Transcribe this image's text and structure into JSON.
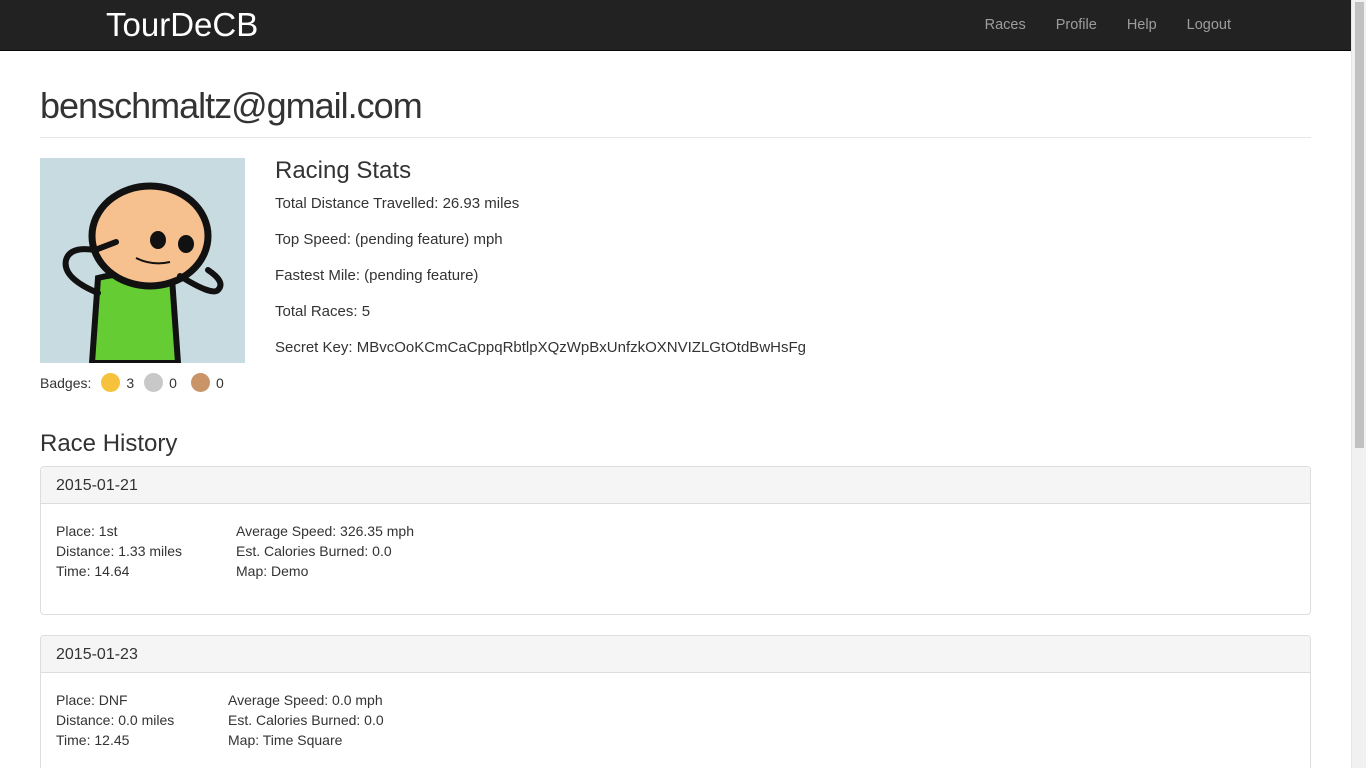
{
  "nav": {
    "brand": "TourDeCB",
    "links": [
      "Races",
      "Profile",
      "Help",
      "Logout"
    ]
  },
  "profile": {
    "email": "benschmaltz@gmail.com",
    "badges_label": "Badges:",
    "badges": {
      "gold": "3",
      "silver": "0",
      "bronze": "0"
    }
  },
  "stats": {
    "title": "Racing Stats",
    "total_distance": "Total Distance Travelled: 26.93 miles",
    "top_speed": "Top Speed: (pending feature) mph",
    "fastest_mile": "Fastest Mile: (pending feature)",
    "total_races": "Total Races: 5",
    "secret_key": "Secret Key: MBvcOoKCmCaCppqRbtlpXQzWpBxUnfzkOXNVIZLGtOtdBwHsFg"
  },
  "history": {
    "title": "Race History",
    "races": [
      {
        "date": "2015-01-21",
        "place": "Place: 1st",
        "distance": "Distance: 1.33 miles",
        "time": "Time: 14.64",
        "avg_speed": "Average Speed: 326.35 mph",
        "calories": "Est. Calories Burned: 0.0",
        "map": "Map: Demo"
      },
      {
        "date": "2015-01-23",
        "place": "Place: DNF",
        "distance": "Distance: 0.0 miles",
        "time": "Time: 12.45",
        "avg_speed": "Average Speed: 0.0 mph",
        "calories": "Est. Calories Burned: 0.0",
        "map": "Map: Time Square"
      }
    ]
  },
  "colors": {
    "navbar": "#222222",
    "nav_link": "#9d9d9d",
    "gold": "#f7c23b",
    "silver": "#c8c8c8",
    "bronze": "#c89468",
    "avatar_bg": "#c8dbe0"
  }
}
